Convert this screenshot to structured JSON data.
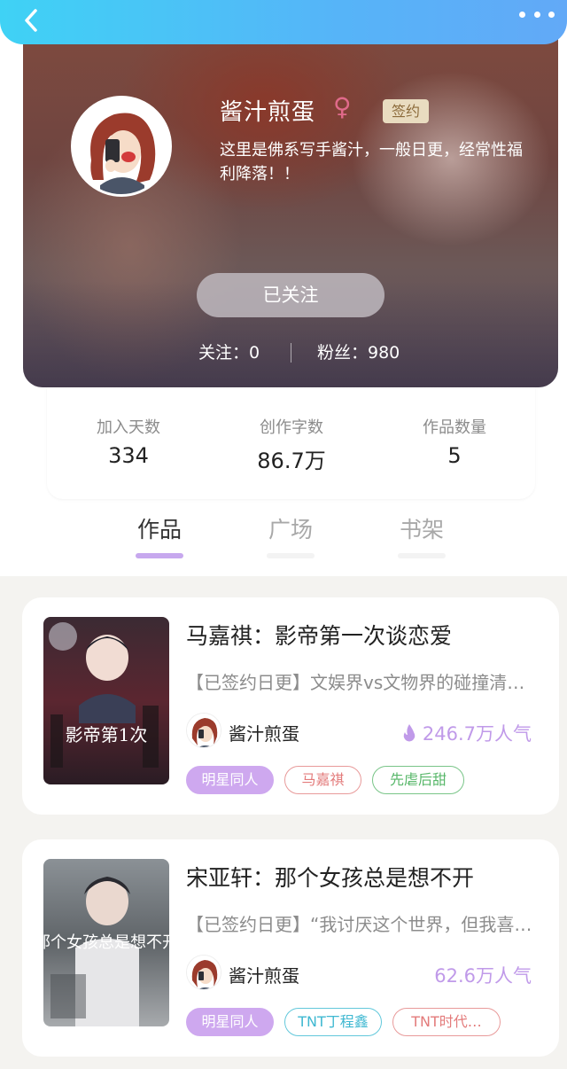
{
  "colors": {
    "accent_purple": "#c7a8ee",
    "header_cyan": "#3fd2f5",
    "header_blue": "#62a9f7"
  },
  "header": {
    "back_icon": "chevron-left-icon",
    "more_icon": "ellipsis-icon"
  },
  "profile": {
    "name": "酱汁煎蛋",
    "gender_symbol": "♀",
    "badge": "签约",
    "bio": "这里是佛系写手酱汁，一般日更，经常性福利降落！！",
    "follow_button": "已关注",
    "following": "关注：0",
    "fans": "粉丝：980"
  },
  "info": [
    {
      "label": "加入天数",
      "value": "334"
    },
    {
      "label": "创作字数",
      "value": "86.7万"
    },
    {
      "label": "作品数量",
      "value": "5"
    }
  ],
  "tabs": [
    {
      "label": "作品",
      "active": true
    },
    {
      "label": "广场",
      "active": false
    },
    {
      "label": "书架",
      "active": false
    }
  ],
  "books": [
    {
      "title": "马嘉祺：影帝第一次谈恋爱",
      "desc": "【已签约日更】文娱界vs文物界的碰撞清…",
      "author": "酱汁煎蛋",
      "popularity": "246.7万人气",
      "cover_text": "影帝第1次",
      "tags": [
        "明星同人",
        "马嘉祺",
        "先虐后甜"
      ]
    },
    {
      "title": "宋亚轩：那个女孩总是想不开",
      "desc": "【已签约日更】“我讨厌这个世界，但我喜…",
      "author": "酱汁煎蛋",
      "popularity": "62.6万人气",
      "cover_text": "那个女孩总是想不开",
      "tags": [
        "明星同人",
        "TNT丁程鑫",
        "TNT时代…"
      ]
    }
  ]
}
